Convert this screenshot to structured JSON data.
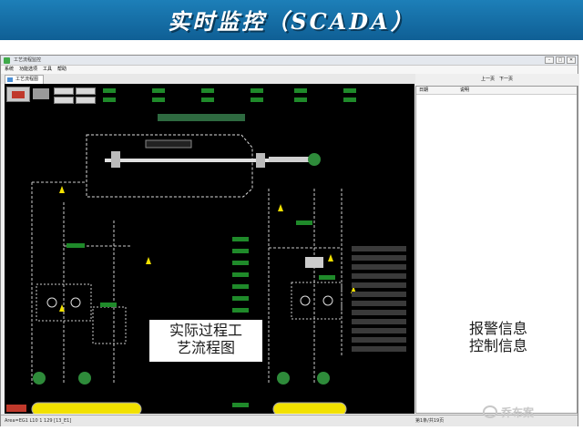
{
  "slide": {
    "title": "实时监控（SCADA）"
  },
  "window": {
    "title": "工艺流程监控",
    "menu": [
      "系统",
      "功能选项",
      "工具",
      "帮助"
    ],
    "tab_label": "工艺流程图",
    "right_toolbar": [
      "上一页",
      "下一页"
    ],
    "right_headers": [
      "日期",
      "说明"
    ]
  },
  "overlays": {
    "process_flow": "实际过程工艺流程图",
    "process_line1": "实际过程工",
    "process_line2": "艺流程图",
    "alarm_line1": "报警信息",
    "alarm_line2": "控制信息"
  },
  "status": {
    "left": "Area=EG1 L10 1 129 [13_E1]",
    "right": "第1条/共19页"
  },
  "watermark": {
    "text": "乔布案"
  },
  "colors": {
    "accent": "#1d7fb8",
    "scada_bg": "#000000",
    "value_green": "#1f8a2a",
    "alarm_red": "#c0392b"
  }
}
